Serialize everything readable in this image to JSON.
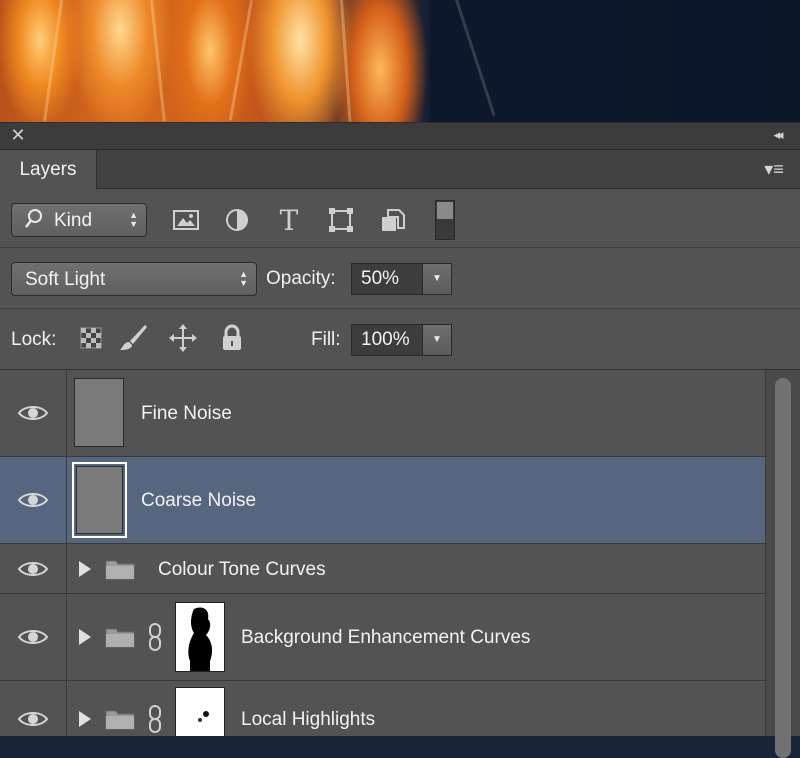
{
  "panel": {
    "close_glyph": "✕",
    "collapse_glyph": "◂◂",
    "tab_label": "Layers",
    "menu_glyph": "▾≡"
  },
  "filter": {
    "search_glyph": "⚲",
    "kind_label": "Kind",
    "type_filter_glyph": "T",
    "icons": [
      "pixel-layer-filter-icon",
      "adjustment-layer-filter-icon",
      "type-layer-filter-icon",
      "shape-layer-filter-icon",
      "smart-object-filter-icon"
    ]
  },
  "blend": {
    "mode": "Soft Light",
    "opacity_label": "Opacity:",
    "opacity_value": "50%"
  },
  "lock": {
    "label": "Lock:",
    "fill_label": "Fill:",
    "fill_value": "100%"
  },
  "layers": [
    {
      "name": "Fine Noise",
      "type": "pixel",
      "visible": true,
      "selected": false
    },
    {
      "name": "Coarse Noise",
      "type": "pixel",
      "visible": true,
      "selected": true
    },
    {
      "name": "Colour Tone Curves",
      "type": "group",
      "visible": true,
      "selected": false
    },
    {
      "name": "Background Enhancement Curves",
      "type": "group-masked",
      "visible": true,
      "selected": false
    },
    {
      "name": "Local Highlights",
      "type": "group-masked",
      "visible": true,
      "selected": false
    }
  ],
  "colors": {
    "panel_bg": "#535353",
    "selected_row": "#56667f",
    "titlebar": "#3c3c3c"
  }
}
